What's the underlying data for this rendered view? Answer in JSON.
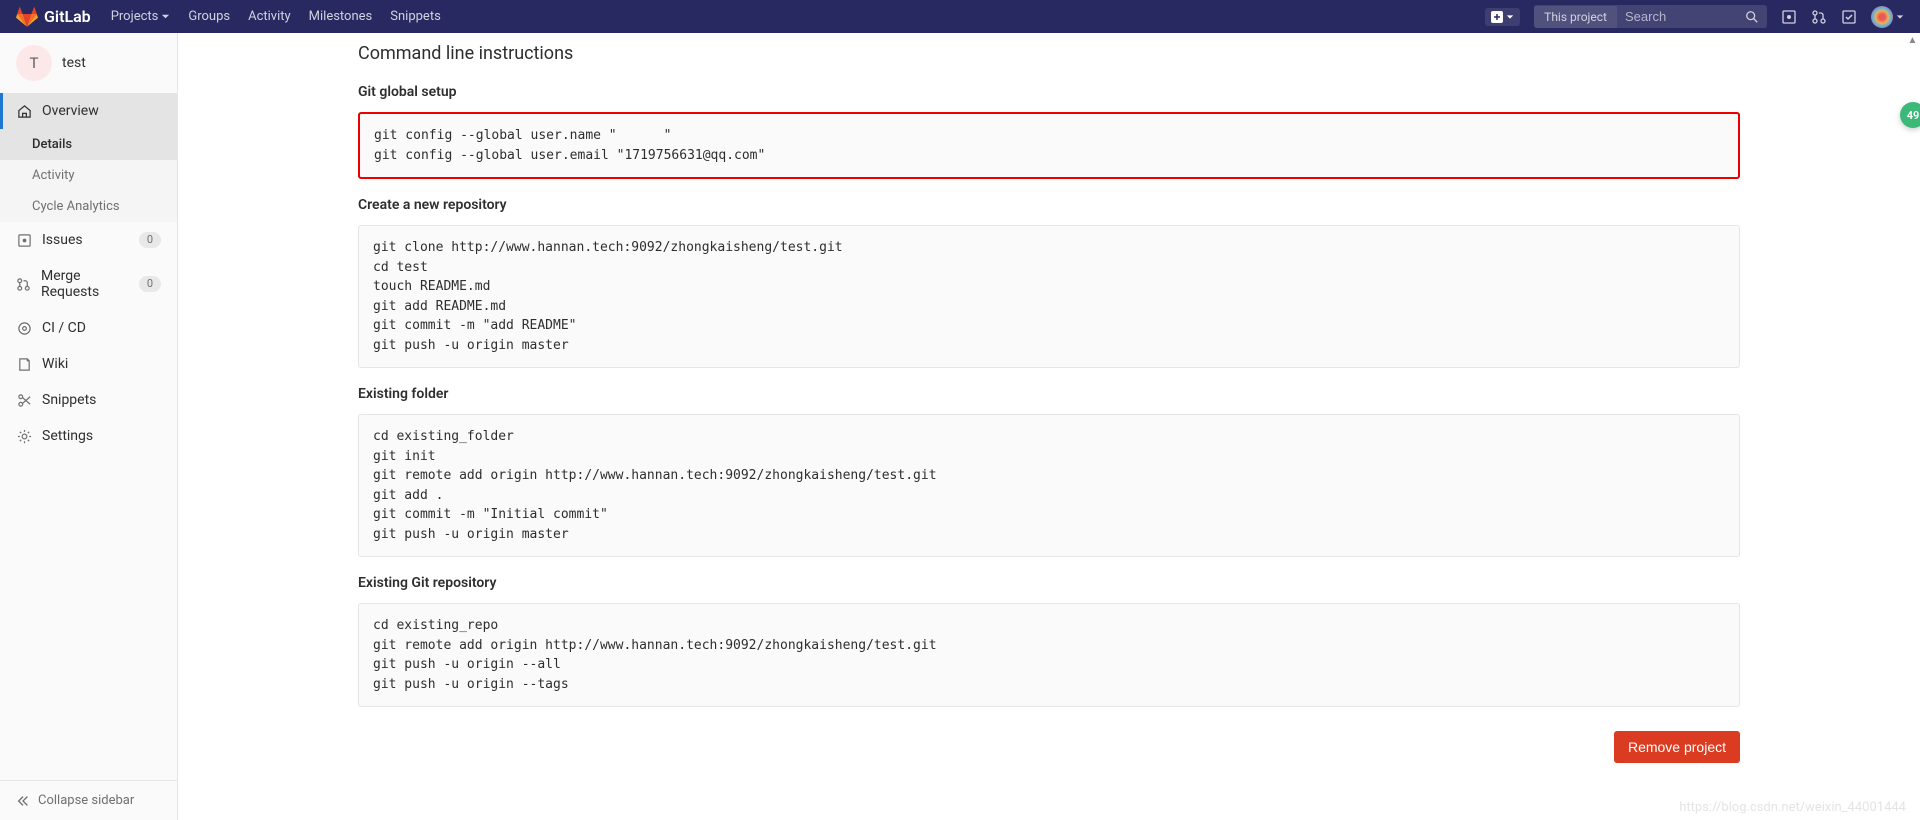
{
  "header": {
    "brand": "GitLab",
    "nav": {
      "projects": "Projects",
      "groups": "Groups",
      "activity": "Activity",
      "milestones": "Milestones",
      "snippets": "Snippets"
    },
    "search_scope": "This project",
    "search_placeholder": "Search"
  },
  "sidebar": {
    "project_initial": "T",
    "project_name": "test",
    "items": {
      "overview": "Overview",
      "details": "Details",
      "activity": "Activity",
      "cycle_analytics": "Cycle Analytics",
      "issues": "Issues",
      "issues_count": "0",
      "merge_requests": "Merge Requests",
      "mr_count": "0",
      "cicd": "CI / CD",
      "wiki": "Wiki",
      "snippets": "Snippets",
      "settings": "Settings"
    },
    "collapse": "Collapse sidebar"
  },
  "main": {
    "title": "Command line instructions",
    "sections": {
      "global_setup": {
        "heading": "Git global setup",
        "code": "git config --global user.name \"      \"\ngit config --global user.email \"1719756631@qq.com\""
      },
      "create_repo": {
        "heading": "Create a new repository",
        "code": "git clone http://www.hannan.tech:9092/zhongkaisheng/test.git\ncd test\ntouch README.md\ngit add README.md\ngit commit -m \"add README\"\ngit push -u origin master"
      },
      "existing_folder": {
        "heading": "Existing folder",
        "code": "cd existing_folder\ngit init\ngit remote add origin http://www.hannan.tech:9092/zhongkaisheng/test.git\ngit add .\ngit commit -m \"Initial commit\"\ngit push -u origin master"
      },
      "existing_repo": {
        "heading": "Existing Git repository",
        "code": "cd existing_repo\ngit remote add origin http://www.hannan.tech:9092/zhongkaisheng/test.git\ngit push -u origin --all\ngit push -u origin --tags"
      }
    },
    "remove_button": "Remove project"
  },
  "toast_count": "49",
  "watermark": "https://blog.csdn.net/weixin_44001444"
}
